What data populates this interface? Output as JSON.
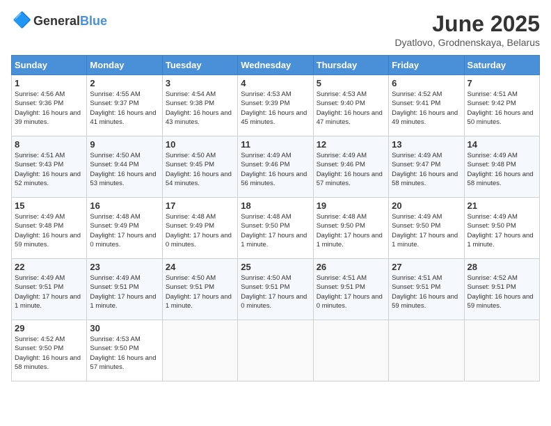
{
  "logo": {
    "general": "General",
    "blue": "Blue"
  },
  "header": {
    "title": "June 2025",
    "subtitle": "Dyatlovo, Grodnenskaya, Belarus"
  },
  "days_of_week": [
    "Sunday",
    "Monday",
    "Tuesday",
    "Wednesday",
    "Thursday",
    "Friday",
    "Saturday"
  ],
  "weeks": [
    [
      {
        "day": 1,
        "sunrise": "4:56 AM",
        "sunset": "9:36 PM",
        "daylight": "16 hours and 39 minutes."
      },
      {
        "day": 2,
        "sunrise": "4:55 AM",
        "sunset": "9:37 PM",
        "daylight": "16 hours and 41 minutes."
      },
      {
        "day": 3,
        "sunrise": "4:54 AM",
        "sunset": "9:38 PM",
        "daylight": "16 hours and 43 minutes."
      },
      {
        "day": 4,
        "sunrise": "4:53 AM",
        "sunset": "9:39 PM",
        "daylight": "16 hours and 45 minutes."
      },
      {
        "day": 5,
        "sunrise": "4:53 AM",
        "sunset": "9:40 PM",
        "daylight": "16 hours and 47 minutes."
      },
      {
        "day": 6,
        "sunrise": "4:52 AM",
        "sunset": "9:41 PM",
        "daylight": "16 hours and 49 minutes."
      },
      {
        "day": 7,
        "sunrise": "4:51 AM",
        "sunset": "9:42 PM",
        "daylight": "16 hours and 50 minutes."
      }
    ],
    [
      {
        "day": 8,
        "sunrise": "4:51 AM",
        "sunset": "9:43 PM",
        "daylight": "16 hours and 52 minutes."
      },
      {
        "day": 9,
        "sunrise": "4:50 AM",
        "sunset": "9:44 PM",
        "daylight": "16 hours and 53 minutes."
      },
      {
        "day": 10,
        "sunrise": "4:50 AM",
        "sunset": "9:45 PM",
        "daylight": "16 hours and 54 minutes."
      },
      {
        "day": 11,
        "sunrise": "4:49 AM",
        "sunset": "9:46 PM",
        "daylight": "16 hours and 56 minutes."
      },
      {
        "day": 12,
        "sunrise": "4:49 AM",
        "sunset": "9:46 PM",
        "daylight": "16 hours and 57 minutes."
      },
      {
        "day": 13,
        "sunrise": "4:49 AM",
        "sunset": "9:47 PM",
        "daylight": "16 hours and 58 minutes."
      },
      {
        "day": 14,
        "sunrise": "4:49 AM",
        "sunset": "9:48 PM",
        "daylight": "16 hours and 58 minutes."
      }
    ],
    [
      {
        "day": 15,
        "sunrise": "4:49 AM",
        "sunset": "9:48 PM",
        "daylight": "16 hours and 59 minutes."
      },
      {
        "day": 16,
        "sunrise": "4:48 AM",
        "sunset": "9:49 PM",
        "daylight": "17 hours and 0 minutes."
      },
      {
        "day": 17,
        "sunrise": "4:48 AM",
        "sunset": "9:49 PM",
        "daylight": "17 hours and 0 minutes."
      },
      {
        "day": 18,
        "sunrise": "4:48 AM",
        "sunset": "9:50 PM",
        "daylight": "17 hours and 1 minute."
      },
      {
        "day": 19,
        "sunrise": "4:48 AM",
        "sunset": "9:50 PM",
        "daylight": "17 hours and 1 minute."
      },
      {
        "day": 20,
        "sunrise": "4:49 AM",
        "sunset": "9:50 PM",
        "daylight": "17 hours and 1 minute."
      },
      {
        "day": 21,
        "sunrise": "4:49 AM",
        "sunset": "9:50 PM",
        "daylight": "17 hours and 1 minute."
      }
    ],
    [
      {
        "day": 22,
        "sunrise": "4:49 AM",
        "sunset": "9:51 PM",
        "daylight": "17 hours and 1 minute."
      },
      {
        "day": 23,
        "sunrise": "4:49 AM",
        "sunset": "9:51 PM",
        "daylight": "17 hours and 1 minute."
      },
      {
        "day": 24,
        "sunrise": "4:50 AM",
        "sunset": "9:51 PM",
        "daylight": "17 hours and 1 minute."
      },
      {
        "day": 25,
        "sunrise": "4:50 AM",
        "sunset": "9:51 PM",
        "daylight": "17 hours and 0 minutes."
      },
      {
        "day": 26,
        "sunrise": "4:51 AM",
        "sunset": "9:51 PM",
        "daylight": "17 hours and 0 minutes."
      },
      {
        "day": 27,
        "sunrise": "4:51 AM",
        "sunset": "9:51 PM",
        "daylight": "16 hours and 59 minutes."
      },
      {
        "day": 28,
        "sunrise": "4:52 AM",
        "sunset": "9:51 PM",
        "daylight": "16 hours and 59 minutes."
      }
    ],
    [
      {
        "day": 29,
        "sunrise": "4:52 AM",
        "sunset": "9:50 PM",
        "daylight": "16 hours and 58 minutes."
      },
      {
        "day": 30,
        "sunrise": "4:53 AM",
        "sunset": "9:50 PM",
        "daylight": "16 hours and 57 minutes."
      },
      null,
      null,
      null,
      null,
      null
    ]
  ],
  "labels": {
    "sunrise": "Sunrise:",
    "sunset": "Sunset:",
    "daylight": "Daylight:"
  }
}
